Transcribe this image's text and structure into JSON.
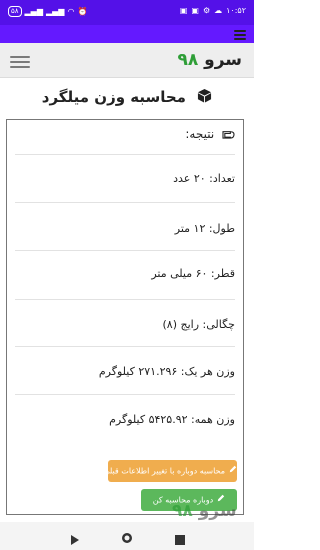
{
  "status_bar": {
    "time": "۱۰:۵۲",
    "battery": "۵۸"
  },
  "site": {
    "logo_text": "سرو",
    "logo_number": "۹۸"
  },
  "page": {
    "title": "محاسبه وزن میلگرد"
  },
  "result": {
    "heading": "نتیجه:",
    "rows": [
      "تعداد: ۲۰ عدد",
      "طول: ۱۲ متر",
      "قطر: ۶۰ میلی متر",
      "چگالی: رایج (۸)",
      "وزن هر یک: ۲۷۱.۲۹۶ کیلوگرم",
      "وزن همه: ۵۴۲۵.۹۲ کیلوگرم"
    ]
  },
  "buttons": {
    "recalc_change": "محاسبه دوباره با تغییر اطلاعات قبلی",
    "recalc": "دوباره محاسبه کن"
  },
  "watermark": {
    "text": "سرو",
    "number": "۹۸"
  },
  "colors": {
    "status_bar": "#5411e8",
    "accent_green": "#2e9e37",
    "warning": "#f0ad4e",
    "success": "#5cb85c"
  },
  "icons": {
    "title_icon": "cube-icon",
    "heading_icon": "hand-pointing-icon",
    "button_icon": "pencil-icon"
  }
}
